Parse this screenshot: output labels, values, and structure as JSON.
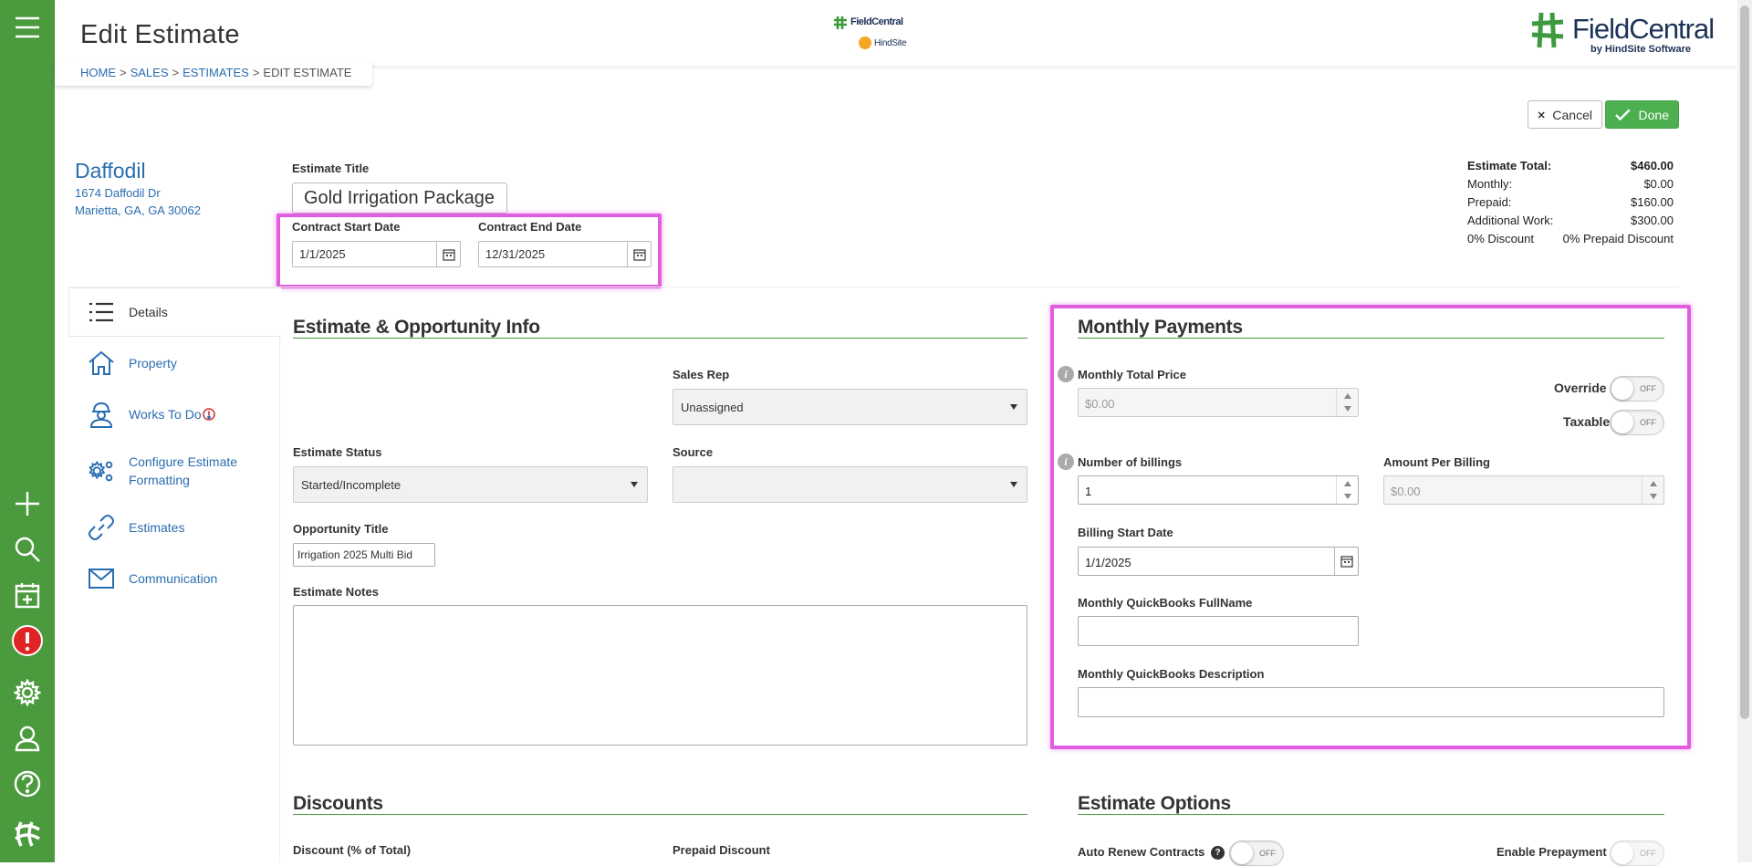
{
  "header": {
    "page_title": "Edit Estimate",
    "center_logo_line1": "FieldCentral",
    "center_logo_line2": "HindSite",
    "brand_name": "FieldCentral",
    "brand_sub": "by HindSite Software"
  },
  "breadcrumb": {
    "home": "HOME",
    "sales": "SALES",
    "estimates": "ESTIMATES",
    "current": "EDIT ESTIMATE",
    "separator": ">"
  },
  "actions": {
    "cancel_label": "Cancel",
    "done_label": "Done"
  },
  "customer": {
    "name": "Daffodil",
    "address_line1": "1674 Daffodil Dr",
    "address_line2": "Marietta, GA, GA 30062"
  },
  "estimate": {
    "title_label": "Estimate Title",
    "title_value": "Gold Irrigation Package",
    "start_label": "Contract Start Date",
    "start_value": "1/1/2025",
    "end_label": "Contract End Date",
    "end_value": "12/31/2025"
  },
  "totals": {
    "total_label": "Estimate Total:",
    "total_value": "$460.00",
    "monthly_label": "Monthly:",
    "monthly_value": "$0.00",
    "prepaid_label": "Prepaid:",
    "prepaid_value": "$160.00",
    "additional_label": "Additional Work:",
    "additional_value": "$300.00",
    "discount_text": "0%  Discount",
    "prepaid_discount_text": "0%  Prepaid Discount"
  },
  "sidenav": {
    "items": [
      {
        "label": "Details",
        "icon": "list-icon"
      },
      {
        "label": "Property",
        "icon": "home-icon"
      },
      {
        "label": "Works To Do",
        "icon": "worker-icon"
      },
      {
        "label": "Configure Estimate",
        "label2": "Formatting",
        "icon": "gears-icon"
      },
      {
        "label": "Estimates",
        "icon": "link-icon"
      },
      {
        "label": "Communication",
        "icon": "envelope-icon"
      }
    ]
  },
  "info": {
    "heading": "Estimate & Opportunity Info",
    "sales_rep_label": "Sales Rep",
    "sales_rep_value": "Unassigned",
    "status_label": "Estimate Status",
    "status_value": "Started/Incomplete",
    "source_label": "Source",
    "source_value": "",
    "opp_title_label": "Opportunity Title",
    "opp_title_value": "Irrigation 2025 Multi Bid",
    "notes_label": "Estimate Notes"
  },
  "monthly": {
    "heading": "Monthly Payments",
    "total_price_label": "Monthly Total Price",
    "total_price_placeholder": "$0.00",
    "override_label": "Override",
    "taxable_label": "Taxable",
    "toggle_off": "OFF",
    "billings_label": "Number of billings",
    "billings_value": "1",
    "amount_label": "Amount Per Billing",
    "amount_placeholder": "$0.00",
    "billing_start_label": "Billing Start Date",
    "billing_start_value": "1/1/2025",
    "qb_fullname_label": "Monthly QuickBooks FullName",
    "qb_desc_label": "Monthly QuickBooks Description"
  },
  "discounts": {
    "heading": "Discounts",
    "discount_label": "Discount (% of Total)",
    "prepaid_label": "Prepaid Discount"
  },
  "options": {
    "heading": "Estimate Options",
    "auto_renew_label": "Auto Renew Contracts",
    "enable_prepay_label": "Enable Prepayment",
    "help": "?"
  },
  "colors": {
    "brand_green": "#4c9a3e",
    "link_blue": "#2a6db0",
    "highlight": "#e15ee1",
    "done_green": "#4caf50"
  }
}
